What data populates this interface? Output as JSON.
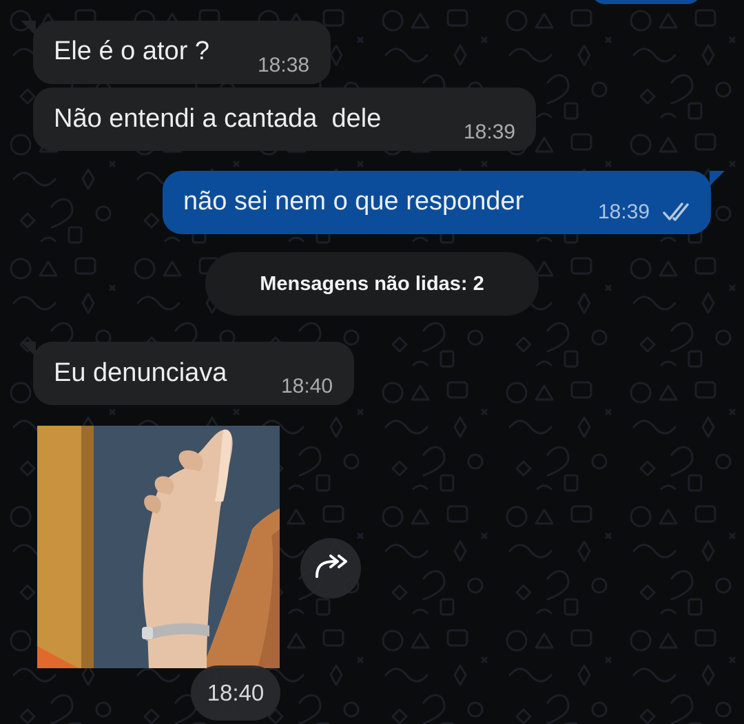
{
  "messages": [
    {
      "direction": "incoming",
      "text": "Ele é o ator ?",
      "time": "18:38"
    },
    {
      "direction": "incoming",
      "text": "Não entendi a cantada  dele",
      "time": "18:39"
    },
    {
      "direction": "outgoing",
      "text": "não sei nem o que responder",
      "time": "18:39",
      "status_icon": "double-check-icon"
    },
    {
      "direction": "incoming",
      "text": "Eu denunciava",
      "time": "18:40"
    }
  ],
  "unread_divider": {
    "label": "Mensagens não lidas: 2"
  },
  "media_message": {
    "kind": "sticker-image",
    "content": "raised hand pointing index finger up",
    "time": "18:40",
    "action_icon": "forward-icon"
  },
  "colors": {
    "background": "#0b0c0e",
    "incoming_bubble": "#212224",
    "outgoing_bubble": "#0b4d9a"
  }
}
